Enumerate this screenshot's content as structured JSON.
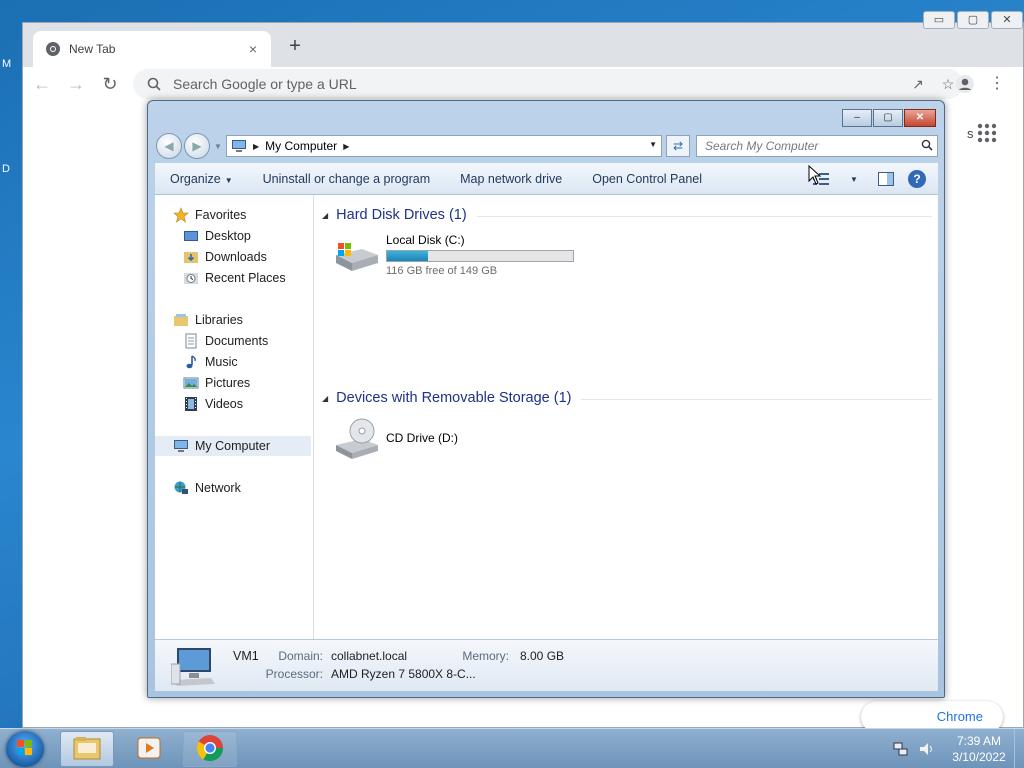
{
  "desktop": {
    "edge_letters": [
      "M",
      "D"
    ]
  },
  "chrome": {
    "tab_title": "New Tab",
    "tab_close": "×",
    "new_tab": "+",
    "omnibox_placeholder": "Search Google or type a URL",
    "customize_label": "Chrome",
    "peek_text": "s",
    "window_controls": [
      "▭",
      "▢",
      "✕"
    ]
  },
  "explorer": {
    "caption": {
      "minimize": "–",
      "maximize": "▢",
      "close": "✕"
    },
    "address": {
      "crumbs": [
        "My Computer"
      ]
    },
    "search_placeholder": "Search My Computer",
    "commands": {
      "organize": "Organize",
      "uninstall": "Uninstall or change a program",
      "map_drive": "Map network drive",
      "control_panel": "Open Control Panel"
    },
    "nav": {
      "favorites": "Favorites",
      "desktop": "Desktop",
      "downloads": "Downloads",
      "recent": "Recent Places",
      "libraries": "Libraries",
      "documents": "Documents",
      "music": "Music",
      "pictures": "Pictures",
      "videos": "Videos",
      "computer": "My Computer",
      "network": "Network"
    },
    "groups": {
      "hdd_title": "Hard Disk Drives (1)",
      "removable_title": "Devices with Removable Storage (1)"
    },
    "drives": {
      "c_name": "Local Disk (C:)",
      "c_free": "116 GB free of 149 GB",
      "c_used_fraction": 0.22,
      "d_name": "CD Drive (D:)"
    },
    "details": {
      "name": "VM1",
      "domain_label": "Domain:",
      "domain_value": "collabnet.local",
      "memory_label": "Memory:",
      "memory_value": "8.00 GB",
      "processor_label": "Processor:",
      "processor_value": "AMD Ryzen 7 5800X 8-C..."
    }
  },
  "taskbar": {
    "time": "7:39 AM",
    "date": "3/10/2022"
  },
  "colors": {
    "accent_link": "#1a73e8",
    "group_title": "#1e3287",
    "capacity_fill": "#1c84b6"
  }
}
